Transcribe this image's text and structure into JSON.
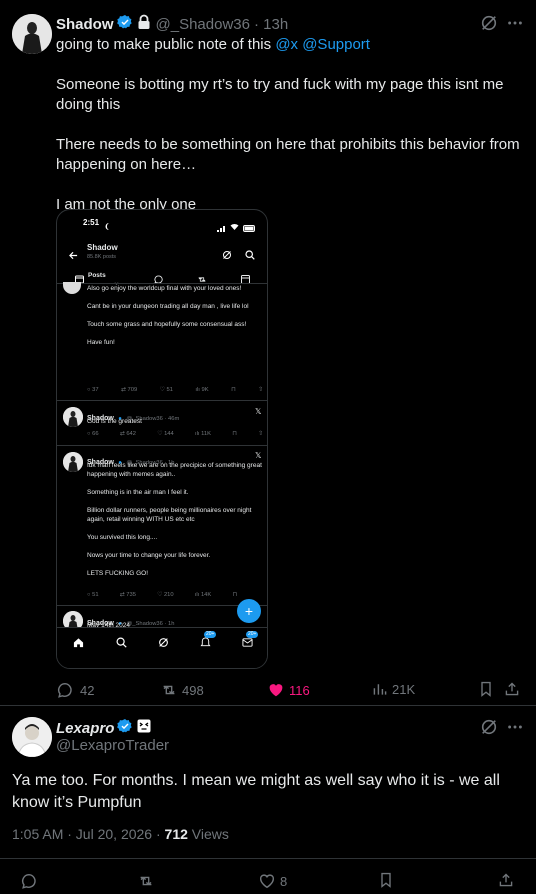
{
  "tweet1": {
    "author_name": "Shadow",
    "handle": "@_Shadow36",
    "time": "· 13h",
    "text_line1_pre": "going to make public note of this ",
    "text_line1_mentions": "@x @Support",
    "para2": "Someone is botting my rt’s to try and fuck with my page this isnt me doing this",
    "para3": "There needs to be something on here that prohibits this behavior from happening on here…",
    "para4": "I am not the only one",
    "actions": {
      "replies": "42",
      "reposts": "498",
      "likes": "116",
      "views": "21K"
    }
  },
  "phone": {
    "status_time": "2:51",
    "header_name": "Shadow",
    "header_posts": "85.8K posts",
    "filter_label": "Posts",
    "post1": {
      "l1": "Also go enjoy the worldcup final with your loved ones!",
      "l2": "Cant be in your dungeon trading all day man , live life lol",
      "l3": "Touch some grass and hopefully some consensual ass!",
      "l4": "Have fun!",
      "stats": [
        "37",
        "709",
        "51",
        "9K"
      ]
    },
    "post2": {
      "name": "Shadow",
      "handle": "@_Shadow36 · 46m",
      "text": "God is the greatest",
      "stats": [
        "66",
        "642",
        "144",
        "11K"
      ]
    },
    "post3": {
      "name": "Shadow",
      "handle": "@_Shadow36 · 1h",
      "l1": "Idk man feels like we are on the precipice of something great happening with memes again..",
      "l2": "Something is in the air man I feel it.",
      "l3": "Billion dollar runners, people being millionaires over night again, retail winning WITH US etc etc",
      "l4": "You survived this long....",
      "l5": "Nows your time to change your life forever.",
      "l6": "LETS FUCKING GO!",
      "stats": [
        "51",
        "735",
        "210",
        "14K"
      ]
    },
    "post4": {
      "name": "Shadow",
      "handle": "@_Shadow36 · 1h",
      "text": "May 14th 2024"
    },
    "badge1": "20+",
    "badge2": "20+"
  },
  "tweet2": {
    "author_name": "Lexapro",
    "handle": "@LexaproTrader",
    "text": "Ya me too. For months. I mean we might as well say who it is - we all know it’s Pumpfun",
    "meta_time": "1:05 AM · Jul 20, 2026 · ",
    "meta_views_count": "712",
    "meta_views_label": " Views",
    "likes": "8"
  },
  "colors": {
    "accent": "#1d9bf0",
    "like": "#f91880",
    "bg": "#000000",
    "muted": "#71767b"
  }
}
